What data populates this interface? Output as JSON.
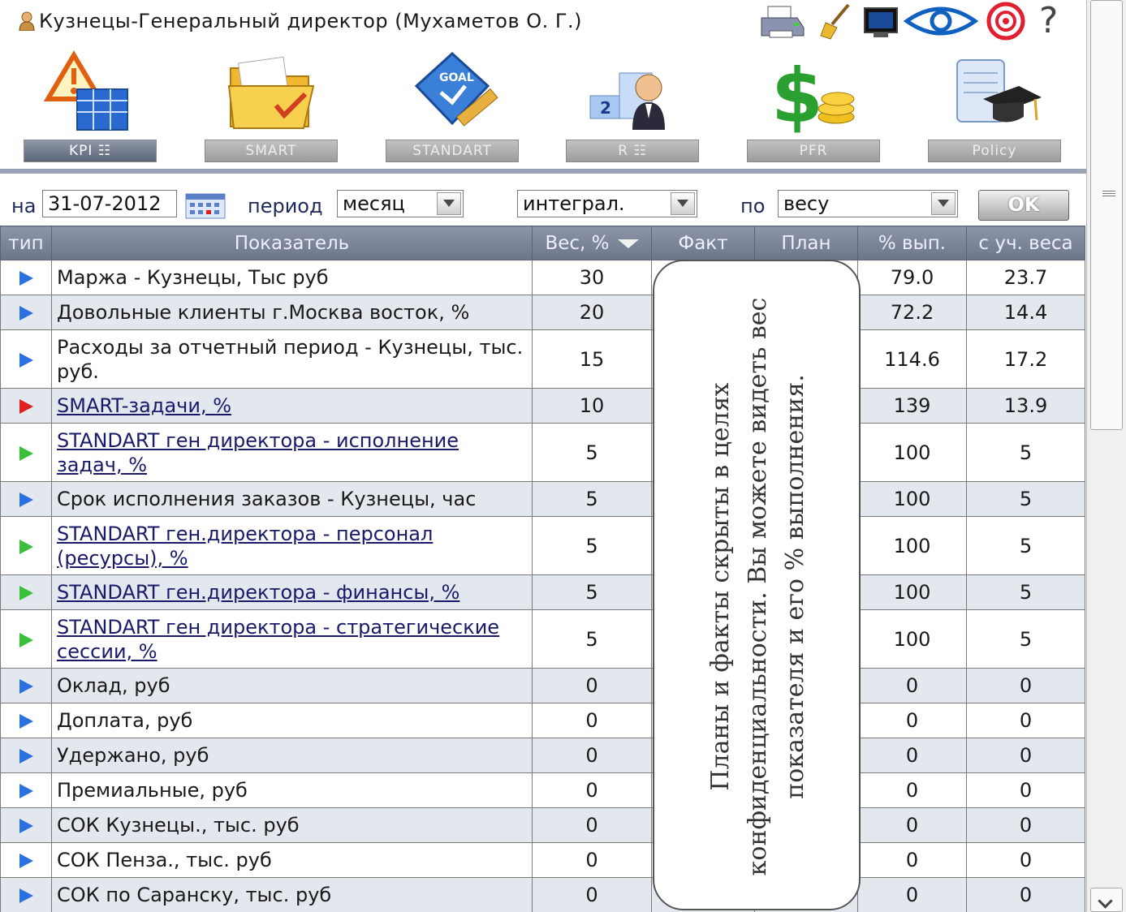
{
  "title": "Кузнецы-Генеральный директор   (Мухаметов О. Г.)",
  "toolbar": {
    "icons": [
      "printer-icon",
      "broom-icon",
      "monitor-icon",
      "eye-icon",
      "target-icon",
      "help-icon"
    ],
    "help_glyph": "?"
  },
  "modules": [
    {
      "label": "KPI  ☷",
      "icon": "kpi-warning-icon",
      "active": true
    },
    {
      "label": "SMART",
      "icon": "folder-icon",
      "active": false
    },
    {
      "label": "STANDART",
      "icon": "goal-ruler-icon",
      "active": false
    },
    {
      "label": "R  ☷",
      "icon": "podium-person-icon",
      "active": false
    },
    {
      "label": "PFR",
      "icon": "dollar-coins-icon",
      "active": false
    },
    {
      "label": "Policy",
      "icon": "scroll-graduation-icon",
      "active": false
    }
  ],
  "filters": {
    "date_label": "на",
    "date_value": "31-07-2012",
    "period_label": "период",
    "period_value": "месяц",
    "mode_value": "интеграл.",
    "by_label": "по",
    "by_value": "весу",
    "ok_label": "OK"
  },
  "table": {
    "headers": [
      "тип",
      "Показатель",
      "Вес, %",
      "Факт",
      "План",
      "% вып.",
      "с уч. веса"
    ],
    "rows": [
      {
        "type": "blue",
        "name": "Маржа - Кузнецы, Тыс руб",
        "link": false,
        "weight": "30",
        "pct": "79.0",
        "weighted": "23.7",
        "h": 43
      },
      {
        "type": "blue",
        "name": "Довольные клиенты г.Москва восток, %",
        "link": false,
        "weight": "20",
        "pct": "72.2",
        "weighted": "14.4",
        "h": 43
      },
      {
        "type": "blue",
        "name": "Расходы за отчетный период - Кузнецы, тыс. руб.",
        "link": false,
        "weight": "15",
        "pct": "114.6",
        "weighted": "17.2",
        "h": 72
      },
      {
        "type": "red",
        "name": "SMART-задачи, %",
        "link": true,
        "weight": "10",
        "pct": "139",
        "weighted": "13.9",
        "h": 43
      },
      {
        "type": "green",
        "name": "STANDART ген директора - исполнение задач, %",
        "link": true,
        "weight": "5",
        "pct": "100",
        "weighted": "5",
        "h": 72
      },
      {
        "type": "blue",
        "name": "Срок исполнения заказов - Кузнецы, час",
        "link": false,
        "weight": "5",
        "pct": "100",
        "weighted": "5",
        "h": 43
      },
      {
        "type": "green",
        "name": "STANDART ген.директора - персонал (ресурсы), %",
        "link": true,
        "weight": "5",
        "pct": "100",
        "weighted": "5",
        "h": 72
      },
      {
        "type": "green",
        "name": "STANDART ген.директора - финансы, %",
        "link": true,
        "weight": "5",
        "pct": "100",
        "weighted": "5",
        "h": 43
      },
      {
        "type": "green",
        "name": "STANDART ген директора - стратегические сессии, %",
        "link": true,
        "weight": "5",
        "pct": "100",
        "weighted": "5",
        "h": 72
      },
      {
        "type": "blue",
        "name": "Оклад, руб",
        "link": false,
        "weight": "0",
        "pct": "0",
        "weighted": "0",
        "h": 43
      },
      {
        "type": "blue",
        "name": "Доплата, руб",
        "link": false,
        "weight": "0",
        "pct": "0",
        "weighted": "0",
        "h": 43
      },
      {
        "type": "blue",
        "name": "Удержано, руб",
        "link": false,
        "weight": "0",
        "pct": "0",
        "weighted": "0",
        "h": 43
      },
      {
        "type": "blue",
        "name": "Премиальные, руб",
        "link": false,
        "weight": "0",
        "pct": "0",
        "weighted": "0",
        "h": 43
      },
      {
        "type": "blue",
        "name": "СОК Кузнецы., тыс. руб",
        "link": false,
        "weight": "0",
        "pct": "0",
        "weighted": "0",
        "h": 43
      },
      {
        "type": "blue",
        "name": "СОК Пенза., тыс. руб",
        "link": false,
        "weight": "0",
        "pct": "0",
        "weighted": "0",
        "h": 43
      },
      {
        "type": "blue",
        "name": "СОК по Саранску, тыс. руб",
        "link": false,
        "weight": "0",
        "pct": "0",
        "weighted": "0",
        "h": 43
      }
    ]
  },
  "overlay_note": "Планы и факты скрыты в целях конфиденциальности. Вы можете видеть вес показателя и его % выполнения.",
  "colors": {
    "blue_marker": "#2a70e0",
    "red_marker": "#e02020",
    "green_marker": "#3abf3a",
    "header_bg": "#7a8497",
    "active_underline": "#d42020"
  }
}
